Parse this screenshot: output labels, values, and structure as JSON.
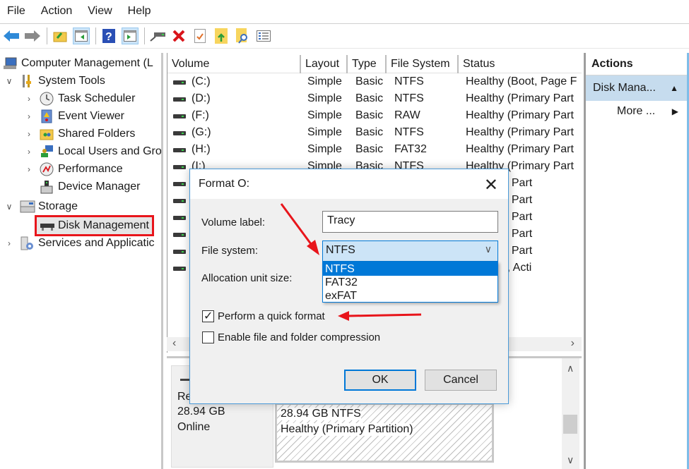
{
  "menu": [
    "File",
    "Action",
    "View",
    "Help"
  ],
  "toolbar": {
    "icons": [
      "back-arrow-icon",
      "forward-arrow-icon",
      "up-folder-icon",
      "show-hide-console-tree-icon",
      "help-icon",
      "show-hide-action-pane-icon",
      "connect-drive-icon",
      "delete-icon",
      "properties-icon",
      "export-icon",
      "search-icon",
      "list-icon"
    ]
  },
  "tree": {
    "root": "Computer Management (L",
    "system_tools": "System Tools",
    "task_scheduler": "Task Scheduler",
    "event_viewer": "Event Viewer",
    "shared_folders": "Shared Folders",
    "local_users": "Local Users and Gro",
    "performance": "Performance",
    "device_manager": "Device Manager",
    "storage": "Storage",
    "disk_management": "Disk Management",
    "services": "Services and Applicatic"
  },
  "volume_list": {
    "columns": [
      "Volume",
      "Layout",
      "Type",
      "File System",
      "Status"
    ],
    "rows": [
      {
        "volume": "(C:)",
        "layout": "Simple",
        "type": "Basic",
        "fs": "NTFS",
        "status": "Healthy (Boot, Page F"
      },
      {
        "volume": "(D:)",
        "layout": "Simple",
        "type": "Basic",
        "fs": "NTFS",
        "status": "Healthy (Primary Part"
      },
      {
        "volume": "(F:)",
        "layout": "Simple",
        "type": "Basic",
        "fs": "RAW",
        "status": "Healthy (Primary Part"
      },
      {
        "volume": "(G:)",
        "layout": "Simple",
        "type": "Basic",
        "fs": "NTFS",
        "status": "Healthy (Primary Part"
      },
      {
        "volume": "(H:)",
        "layout": "Simple",
        "type": "Basic",
        "fs": "FAT32",
        "status": "Healthy (Primary Part"
      },
      {
        "volume": "(I:)",
        "layout": "Simple",
        "type": "Basic",
        "fs": "NTFS",
        "status": "Healthy (Primary Part"
      },
      {
        "volume": "",
        "layout": "",
        "type": "",
        "fs": "",
        "status": "(Primary Part"
      },
      {
        "volume": "",
        "layout": "",
        "type": "",
        "fs": "",
        "status": "(Primary Part"
      },
      {
        "volume": "",
        "layout": "",
        "type": "",
        "fs": "",
        "status": "(Primary Part"
      },
      {
        "volume": "",
        "layout": "",
        "type": "",
        "fs": "",
        "status": "(Primary Part"
      },
      {
        "volume": "",
        "layout": "",
        "type": "",
        "fs": "",
        "status": "(Primary Part"
      },
      {
        "volume": "",
        "layout": "",
        "type": "",
        "fs": "",
        "status": "(System, Acti"
      }
    ]
  },
  "disk": {
    "name_partial": "Re",
    "size": "28.94 GB",
    "state": "Online",
    "partition_size": "28.94 GB NTFS",
    "partition_status": "Healthy (Primary Partition)"
  },
  "actions": {
    "title": "Actions",
    "section": "Disk Mana...",
    "more": "More ..."
  },
  "dialog": {
    "title": "Format O:",
    "volume_label_text": "Volume label:",
    "volume_label_value": "Tracy",
    "file_system_text": "File system:",
    "file_system_value": "NTFS",
    "file_system_options": [
      "NTFS",
      "FAT32",
      "exFAT"
    ],
    "allocation_text": "Allocation unit size:",
    "quick_format_text": "Perform a quick format",
    "quick_format_checked": true,
    "compression_text": "Enable file and folder compression",
    "compression_checked": false,
    "ok": "OK",
    "cancel": "Cancel"
  },
  "colors": {
    "highlight_red": "#e8151b",
    "selection_blue": "#0078d7",
    "actions_header": "#c6dcee"
  }
}
